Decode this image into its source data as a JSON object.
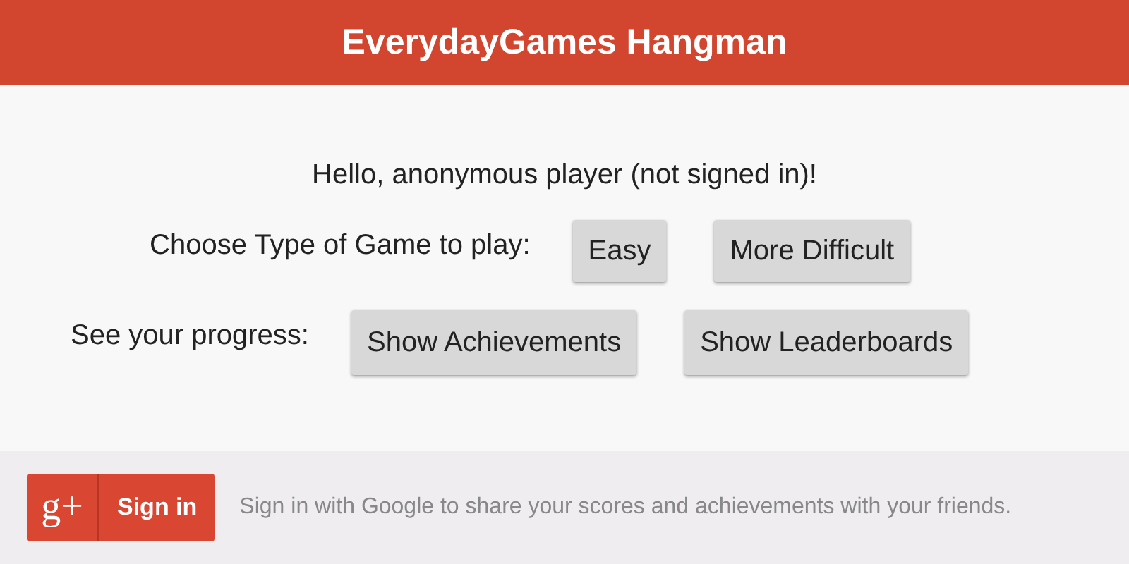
{
  "header": {
    "title": "EverydayGames Hangman"
  },
  "greeting": "Hello, anonymous player (not signed in)!",
  "rows": [
    {
      "label": "Choose Type of Game to play:",
      "buttons": [
        "Easy",
        "More Difficult"
      ]
    },
    {
      "label": "See your progress:",
      "buttons": [
        "Show Achievements",
        "Show Leaderboards"
      ]
    }
  ],
  "footer": {
    "logo": "g+",
    "sign_in": "Sign in",
    "message": "Sign in with Google to share your scores and achievements with your friends."
  }
}
